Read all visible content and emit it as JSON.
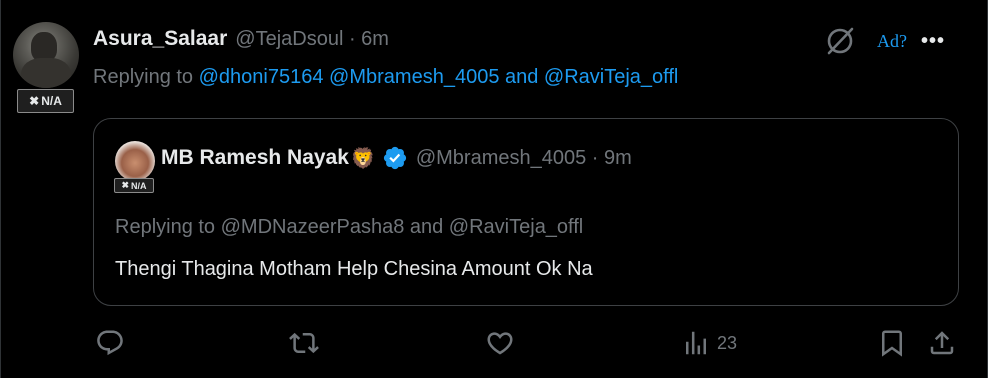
{
  "post": {
    "author_name": "Asura_Salaar",
    "handle_time": "@TejaDsoul · 6m",
    "badge": "N/A",
    "replying_prefix": "Replying to ",
    "mentions": [
      "@dhoni75164",
      "@Mbramesh_4005"
    ],
    "and_word": " and ",
    "last_mention": "@RaviTeja_offl",
    "ad_label": "Ad?",
    "more_label": "•••"
  },
  "quoted": {
    "author_name": "MB Ramesh Nayak",
    "emoji": "🦁",
    "handle_time": "@Mbramesh_4005 · 9m",
    "badge": "N/A",
    "replying_line": "Replying to @MDNazeerPasha8 and @RaviTeja_offl",
    "text": "Thengi Thagina Motham Help Chesina Amount Ok Na"
  },
  "actions": {
    "views_count": "23",
    "icons": [
      "reply-icon",
      "retweet-icon",
      "like-icon",
      "views-icon",
      "bookmark-icon",
      "share-icon"
    ]
  },
  "colors": {
    "background": "#000000",
    "text": "#e7e9ea",
    "muted": "#71767b",
    "accent": "#1d9bf0",
    "border": "#3e4144"
  }
}
